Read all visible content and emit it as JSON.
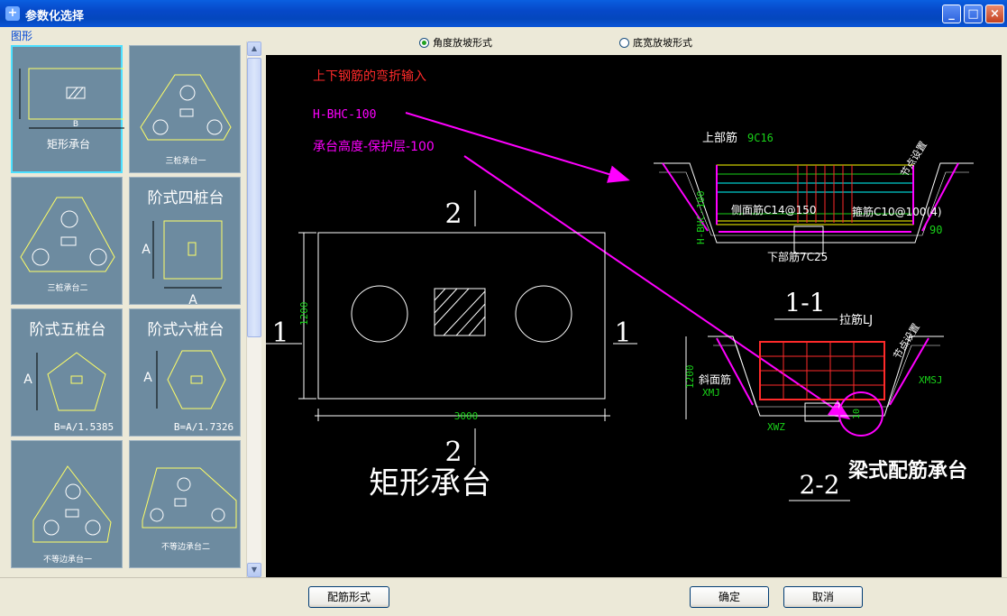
{
  "window": {
    "title": "参数化选择",
    "minimize": "_",
    "maximize": "□",
    "close": "×"
  },
  "left_panel": {
    "group_label": "图形",
    "thumbnails": [
      {
        "label": "矩形承台",
        "dim": "B"
      },
      {
        "label": "三桩承台一"
      },
      {
        "label": "三桩承台二"
      },
      {
        "label": "阶式四桩台",
        "dim": "A"
      },
      {
        "label": "阶式五桩台",
        "formula": "B=A/1.5385",
        "dim": "A"
      },
      {
        "label": "阶式六桩台",
        "formula": "B=A/1.7326",
        "dim": "A"
      },
      {
        "label": "不等边承台一"
      },
      {
        "label": "不等边承台二"
      }
    ]
  },
  "radio_options": [
    {
      "label": "角度放坡形式",
      "selected": true
    },
    {
      "label": "底宽放坡形式",
      "selected": false
    }
  ],
  "drawing": {
    "notes": {
      "header": "上下钢筋的弯折输入",
      "h_bhc": "H-BHC-100",
      "height_cover": "承台高度-保护层-100"
    },
    "plan": {
      "section_top": "2",
      "section_bottom": "2",
      "section_left": "1",
      "section_right": "1",
      "width": "3000",
      "height": "1200",
      "name": "矩形承台"
    },
    "section_1_1": {
      "title": "1-1",
      "top_bar": "上部筋",
      "top_bar_spec": "9C16",
      "side_bar": "侧面筋C14@150",
      "stirrup": "箍筋C10@100(4)",
      "bottom_bar": "下部筋7C25",
      "side_label": "H-BHC-100",
      "angle": "90",
      "slope": "节点设置"
    },
    "section_2_2": {
      "title": "2-2",
      "tie_bar": "拉筋LJ",
      "slope_bar": "斜面筋",
      "xmj": "XMJ",
      "xmsj": "XMSJ",
      "xwz": "XWZ",
      "height": "1200",
      "dim_10": "10",
      "slope": "节点设置"
    },
    "title_right": "梁式配筋承台",
    "colors": {
      "red": "#ff2a2a",
      "magenta": "#ff00ff",
      "white": "#ffffff",
      "green": "#19d219",
      "yellow": "#ffff00",
      "cyan": "#00ffff"
    }
  },
  "buttons": {
    "rebar_form": "配筋形式",
    "ok": "确定",
    "cancel": "取消"
  }
}
